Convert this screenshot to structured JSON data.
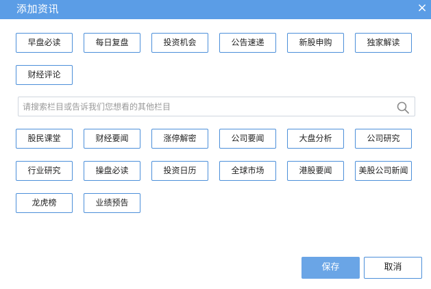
{
  "dialog": {
    "title": "添加资讯",
    "close_glyph": "×"
  },
  "top_tags": [
    "早盘必读",
    "每日复盘",
    "投资机会",
    "公告速递",
    "新股申购",
    "独家解读",
    "财经评论"
  ],
  "search": {
    "placeholder": "请搜索栏目或告诉我们您想看的其他栏目",
    "value": ""
  },
  "bottom_tags": [
    "股民课堂",
    "财经要闻",
    "涨停解密",
    "公司要闻",
    "大盘分析",
    "公司研究",
    "行业研究",
    "操盘必读",
    "投资日历",
    "全球市场",
    "港股要闻",
    "美股公司新闻",
    "龙虎榜",
    "业绩预告"
  ],
  "actions": {
    "save_label": "保存",
    "cancel_label": "取消"
  },
  "colors": {
    "title_bar": "#5b9de6",
    "tag_border": "#4a8ed9",
    "save_button": "#6aa5e6"
  },
  "icons": {
    "close": "close-icon",
    "search": "search-icon"
  }
}
